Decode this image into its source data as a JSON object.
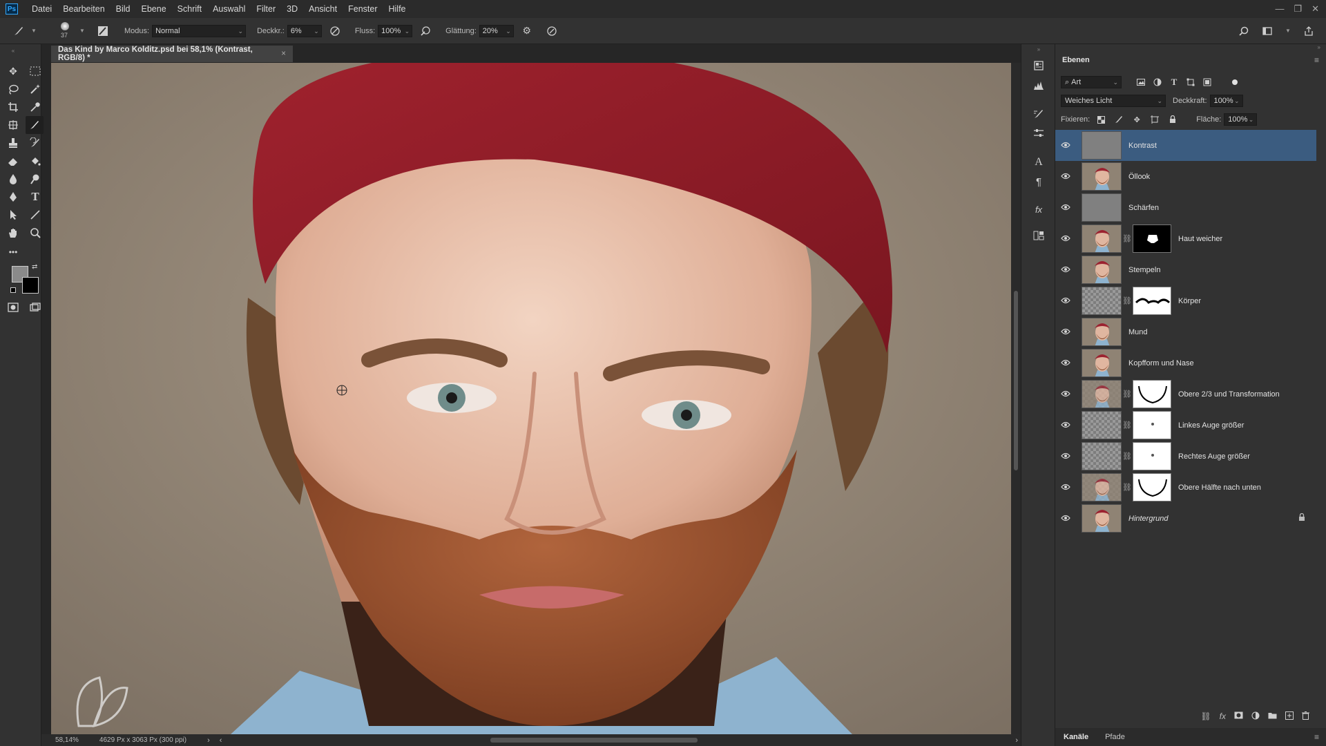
{
  "menu": {
    "logo": "Ps",
    "items": [
      "Datei",
      "Bearbeiten",
      "Bild",
      "Ebene",
      "Schrift",
      "Auswahl",
      "Filter",
      "3D",
      "Ansicht",
      "Fenster",
      "Hilfe"
    ]
  },
  "options_bar": {
    "brush_size": "37",
    "modus_label": "Modus:",
    "modus_value": "Normal",
    "deckkraft_label": "Deckkr.:",
    "deckkraft_value": "6%",
    "fluss_label": "Fluss:",
    "fluss_value": "100%",
    "glaettung_label": "Glättung:",
    "glaettung_value": "20%"
  },
  "document": {
    "tab_title": "Das Kind by Marco Kolditz.psd bei 58,1% (Kontrast, RGB/8) *",
    "close": "×"
  },
  "status": {
    "zoom": "58,14%",
    "dimensions": "4629 Px x 3063 Px (300 ppi)"
  },
  "layers_panel": {
    "tab": "Ebenen",
    "filter_kind": "Art",
    "blend_mode": "Weiches Licht",
    "opacity_label": "Deckkraft:",
    "opacity_value": "100%",
    "lock_label": "Fixieren:",
    "fill_label": "Fläche:",
    "fill_value": "100%",
    "layers": [
      {
        "name": "Kontrast",
        "thumb": "gray",
        "mask": null,
        "selected": true,
        "italic": false,
        "locked": false
      },
      {
        "name": "Öllook",
        "thumb": "photo",
        "mask": null,
        "selected": false,
        "italic": false,
        "locked": false
      },
      {
        "name": "Schärfen",
        "thumb": "gray",
        "mask": null,
        "selected": false,
        "italic": false,
        "locked": false
      },
      {
        "name": "Haut weicher",
        "thumb": "photo",
        "mask": "black",
        "selected": false,
        "italic": false,
        "locked": false
      },
      {
        "name": "Stempeln",
        "thumb": "photo",
        "mask": null,
        "selected": false,
        "italic": false,
        "locked": false
      },
      {
        "name": "Körper",
        "thumb": "checker",
        "mask": "white-stroke",
        "selected": false,
        "italic": false,
        "locked": false
      },
      {
        "name": "Mund",
        "thumb": "photo",
        "mask": null,
        "selected": false,
        "italic": false,
        "locked": false
      },
      {
        "name": "Kopfform und Nase",
        "thumb": "photo",
        "mask": null,
        "selected": false,
        "italic": false,
        "locked": false
      },
      {
        "name": "Obere 2/3 und Transformation",
        "thumb": "photo-checker",
        "mask": "white-curve",
        "selected": false,
        "italic": false,
        "locked": false
      },
      {
        "name": "Linkes Auge größer",
        "thumb": "checker",
        "mask": "white-dot",
        "selected": false,
        "italic": false,
        "locked": false
      },
      {
        "name": "Rechtes Auge größer",
        "thumb": "checker",
        "mask": "white-dot",
        "selected": false,
        "italic": false,
        "locked": false
      },
      {
        "name": "Obere Hälfte nach unten",
        "thumb": "photo-checker",
        "mask": "white-curve",
        "selected": false,
        "italic": false,
        "locked": false
      },
      {
        "name": "Hintergrund",
        "thumb": "photo",
        "mask": null,
        "selected": false,
        "italic": true,
        "locked": true
      }
    ]
  },
  "bottom_tabs": [
    "Kanäle",
    "Pfade"
  ]
}
